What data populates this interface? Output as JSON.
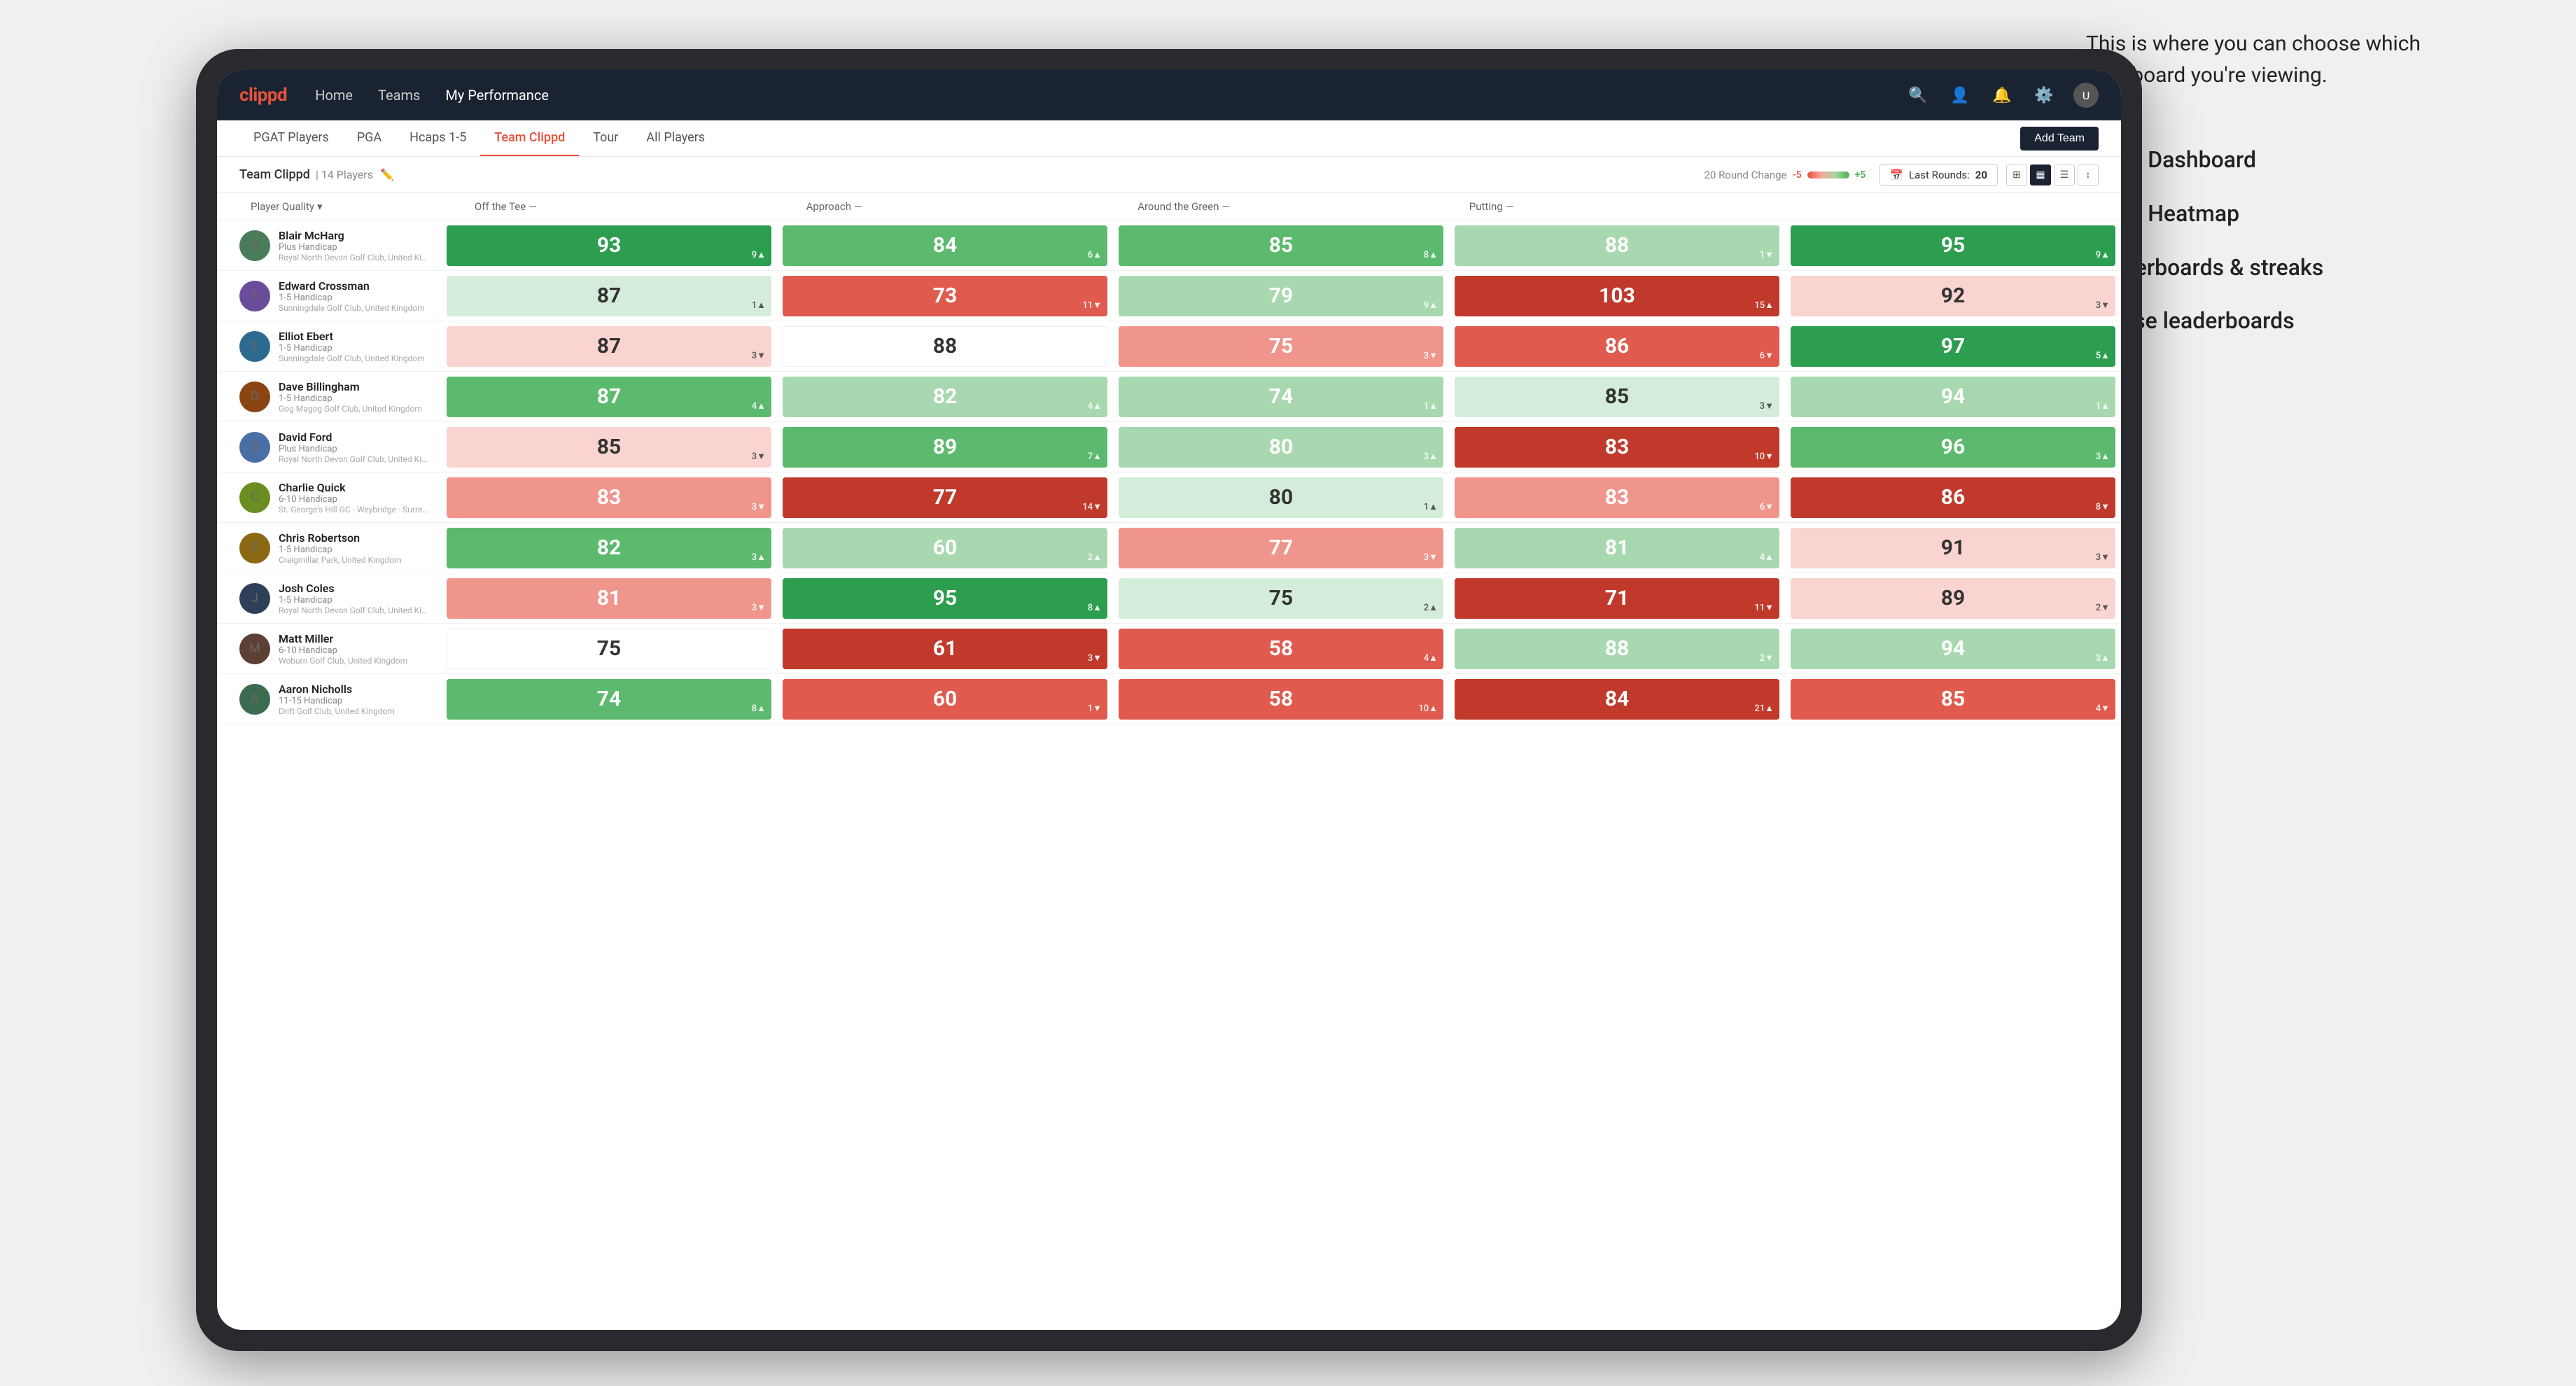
{
  "annotation": {
    "intro": "This is where you can choose which dashboard you're viewing.",
    "options": [
      "Team Dashboard",
      "Team Heatmap",
      "Leaderboards & streaks",
      "Course leaderboards"
    ]
  },
  "nav": {
    "logo": "clippd",
    "items": [
      "Home",
      "Teams",
      "My Performance"
    ],
    "active": "My Performance"
  },
  "sub_nav": {
    "items": [
      "PGAT Players",
      "PGA",
      "Hcaps 1-5",
      "Team Clippd",
      "Tour",
      "All Players"
    ],
    "active": "Team Clippd",
    "add_button": "Add Team"
  },
  "team_header": {
    "title": "Team Clippd",
    "count": "14 Players",
    "round_change_label": "20 Round Change",
    "neg": "-5",
    "pos": "+5",
    "last_rounds_label": "Last Rounds:",
    "last_rounds_value": "20"
  },
  "col_headers": {
    "player": "Player Quality",
    "tee": "Off the Tee",
    "approach": "Approach",
    "around": "Around the Green",
    "putting": "Putting"
  },
  "players": [
    {
      "name": "Blair McHarg",
      "handicap": "Plus Handicap",
      "club": "Royal North Devon Golf Club, United Kingdom",
      "scores": [
        {
          "value": "93",
          "change": "9▲",
          "color": "green-strong",
          "text": "light"
        },
        {
          "value": "84",
          "change": "6▲",
          "color": "green-mid",
          "text": "light"
        },
        {
          "value": "85",
          "change": "8▲",
          "color": "green-mid",
          "text": "light"
        },
        {
          "value": "88",
          "change": "1▼",
          "color": "green-light",
          "text": "light"
        },
        {
          "value": "95",
          "change": "9▲",
          "color": "green-strong",
          "text": "light"
        }
      ]
    },
    {
      "name": "Edward Crossman",
      "handicap": "1-5 Handicap",
      "club": "Sunningdale Golf Club, United Kingdom",
      "scores": [
        {
          "value": "87",
          "change": "1▲",
          "color": "green-pale",
          "text": "dark"
        },
        {
          "value": "73",
          "change": "11▼",
          "color": "red-mid",
          "text": "light"
        },
        {
          "value": "79",
          "change": "9▲",
          "color": "green-light",
          "text": "light"
        },
        {
          "value": "103",
          "change": "15▲",
          "color": "red-strong",
          "text": "light"
        },
        {
          "value": "92",
          "change": "3▼",
          "color": "red-pale",
          "text": "dark"
        }
      ]
    },
    {
      "name": "Elliot Ebert",
      "handicap": "1-5 Handicap",
      "club": "Sunningdale Golf Club, United Kingdom",
      "scores": [
        {
          "value": "87",
          "change": "3▼",
          "color": "red-pale",
          "text": "dark"
        },
        {
          "value": "88",
          "change": "",
          "color": "white",
          "text": "dark"
        },
        {
          "value": "75",
          "change": "3▼",
          "color": "red-light",
          "text": "light"
        },
        {
          "value": "86",
          "change": "6▼",
          "color": "red-mid",
          "text": "light"
        },
        {
          "value": "97",
          "change": "5▲",
          "color": "green-strong",
          "text": "light"
        }
      ]
    },
    {
      "name": "Dave Billingham",
      "handicap": "1-5 Handicap",
      "club": "Gog Magog Golf Club, United Kingdom",
      "scores": [
        {
          "value": "87",
          "change": "4▲",
          "color": "green-mid",
          "text": "light"
        },
        {
          "value": "82",
          "change": "4▲",
          "color": "green-light",
          "text": "light"
        },
        {
          "value": "74",
          "change": "1▲",
          "color": "green-light",
          "text": "light"
        },
        {
          "value": "85",
          "change": "3▼",
          "color": "green-pale",
          "text": "dark"
        },
        {
          "value": "94",
          "change": "1▲",
          "color": "green-light",
          "text": "light"
        }
      ]
    },
    {
      "name": "David Ford",
      "handicap": "Plus Handicap",
      "club": "Royal North Devon Golf Club, United Kingdom",
      "scores": [
        {
          "value": "85",
          "change": "3▼",
          "color": "red-pale",
          "text": "dark"
        },
        {
          "value": "89",
          "change": "7▲",
          "color": "green-mid",
          "text": "light"
        },
        {
          "value": "80",
          "change": "3▲",
          "color": "green-light",
          "text": "light"
        },
        {
          "value": "83",
          "change": "10▼",
          "color": "red-strong",
          "text": "light"
        },
        {
          "value": "96",
          "change": "3▲",
          "color": "green-mid",
          "text": "light"
        }
      ]
    },
    {
      "name": "Charlie Quick",
      "handicap": "6-10 Handicap",
      "club": "St. George's Hill GC - Weybridge - Surrey, Uni...",
      "scores": [
        {
          "value": "83",
          "change": "3▼",
          "color": "red-light",
          "text": "light"
        },
        {
          "value": "77",
          "change": "14▼",
          "color": "red-strong",
          "text": "light"
        },
        {
          "value": "80",
          "change": "1▲",
          "color": "green-pale",
          "text": "dark"
        },
        {
          "value": "83",
          "change": "6▼",
          "color": "red-light",
          "text": "light"
        },
        {
          "value": "86",
          "change": "8▼",
          "color": "red-strong",
          "text": "light"
        }
      ]
    },
    {
      "name": "Chris Robertson",
      "handicap": "1-5 Handicap",
      "club": "Craigmillar Park, United Kingdom",
      "scores": [
        {
          "value": "82",
          "change": "3▲",
          "color": "green-mid",
          "text": "light"
        },
        {
          "value": "60",
          "change": "2▲",
          "color": "green-light",
          "text": "light"
        },
        {
          "value": "77",
          "change": "3▼",
          "color": "red-light",
          "text": "light"
        },
        {
          "value": "81",
          "change": "4▲",
          "color": "green-light",
          "text": "light"
        },
        {
          "value": "91",
          "change": "3▼",
          "color": "red-pale",
          "text": "dark"
        }
      ]
    },
    {
      "name": "Josh Coles",
      "handicap": "1-5 Handicap",
      "club": "Royal North Devon Golf Club, United Kingdom",
      "scores": [
        {
          "value": "81",
          "change": "3▼",
          "color": "red-light",
          "text": "light"
        },
        {
          "value": "95",
          "change": "8▲",
          "color": "green-strong",
          "text": "light"
        },
        {
          "value": "75",
          "change": "2▲",
          "color": "green-pale",
          "text": "dark"
        },
        {
          "value": "71",
          "change": "11▼",
          "color": "red-strong",
          "text": "light"
        },
        {
          "value": "89",
          "change": "2▼",
          "color": "red-pale",
          "text": "dark"
        }
      ]
    },
    {
      "name": "Matt Miller",
      "handicap": "6-10 Handicap",
      "club": "Woburn Golf Club, United Kingdom",
      "scores": [
        {
          "value": "75",
          "change": "",
          "color": "white",
          "text": "dark"
        },
        {
          "value": "61",
          "change": "3▼",
          "color": "red-strong",
          "text": "light"
        },
        {
          "value": "58",
          "change": "4▲",
          "color": "red-mid",
          "text": "light"
        },
        {
          "value": "88",
          "change": "2▼",
          "color": "green-light",
          "text": "light"
        },
        {
          "value": "94",
          "change": "3▲",
          "color": "green-light",
          "text": "light"
        }
      ]
    },
    {
      "name": "Aaron Nicholls",
      "handicap": "11-15 Handicap",
      "club": "Drift Golf Club, United Kingdom",
      "scores": [
        {
          "value": "74",
          "change": "8▲",
          "color": "green-mid",
          "text": "light"
        },
        {
          "value": "60",
          "change": "1▼",
          "color": "red-mid",
          "text": "light"
        },
        {
          "value": "58",
          "change": "10▲",
          "color": "red-mid",
          "text": "light"
        },
        {
          "value": "84",
          "change": "21▲",
          "color": "red-strong",
          "text": "light"
        },
        {
          "value": "85",
          "change": "4▼",
          "color": "red-mid",
          "text": "light"
        }
      ]
    }
  ]
}
